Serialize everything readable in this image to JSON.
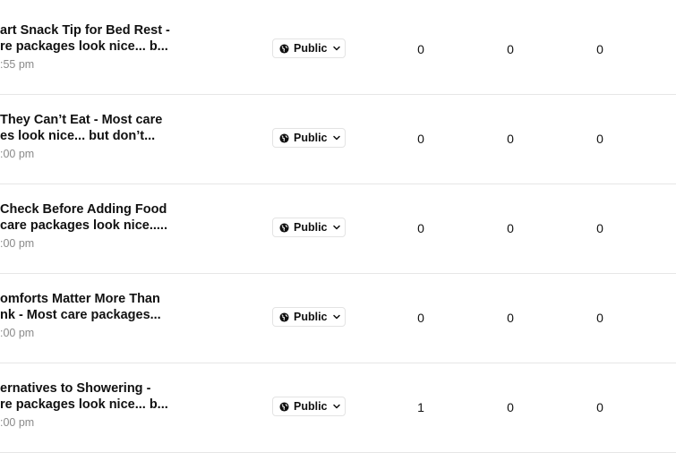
{
  "posts": [
    {
      "title_line1": "art Snack Tip for Bed Rest -",
      "title_line2": "re packages look nice... b...",
      "date": ":55 pm",
      "privacy": "Public",
      "stat1": "0",
      "stat2": "0",
      "stat3": "0"
    },
    {
      "title_line1": "They Can’t Eat - Most care",
      "title_line2": "es look nice... but don’t...",
      "date": ":00 pm",
      "privacy": "Public",
      "stat1": "0",
      "stat2": "0",
      "stat3": "0"
    },
    {
      "title_line1": "Check Before Adding Food",
      "title_line2": "care packages look nice.....",
      "date": ":00 pm",
      "privacy": "Public",
      "stat1": "0",
      "stat2": "0",
      "stat3": "0"
    },
    {
      "title_line1": "omforts Matter More Than",
      "title_line2": "nk - Most care packages...",
      "date": ":00 pm",
      "privacy": "Public",
      "stat1": "0",
      "stat2": "0",
      "stat3": "0"
    },
    {
      "title_line1": "ernatives to Showering -",
      "title_line2": "re packages look nice... b...",
      "date": ":00 pm",
      "privacy": "Public",
      "stat1": "1",
      "stat2": "0",
      "stat3": "0"
    }
  ],
  "icons": {
    "privacy": "globe-icon",
    "dropdown": "chevron-down-icon"
  },
  "colors": {
    "text": "#111111",
    "muted": "#8a8a8a",
    "divider": "#e6e6e6"
  }
}
